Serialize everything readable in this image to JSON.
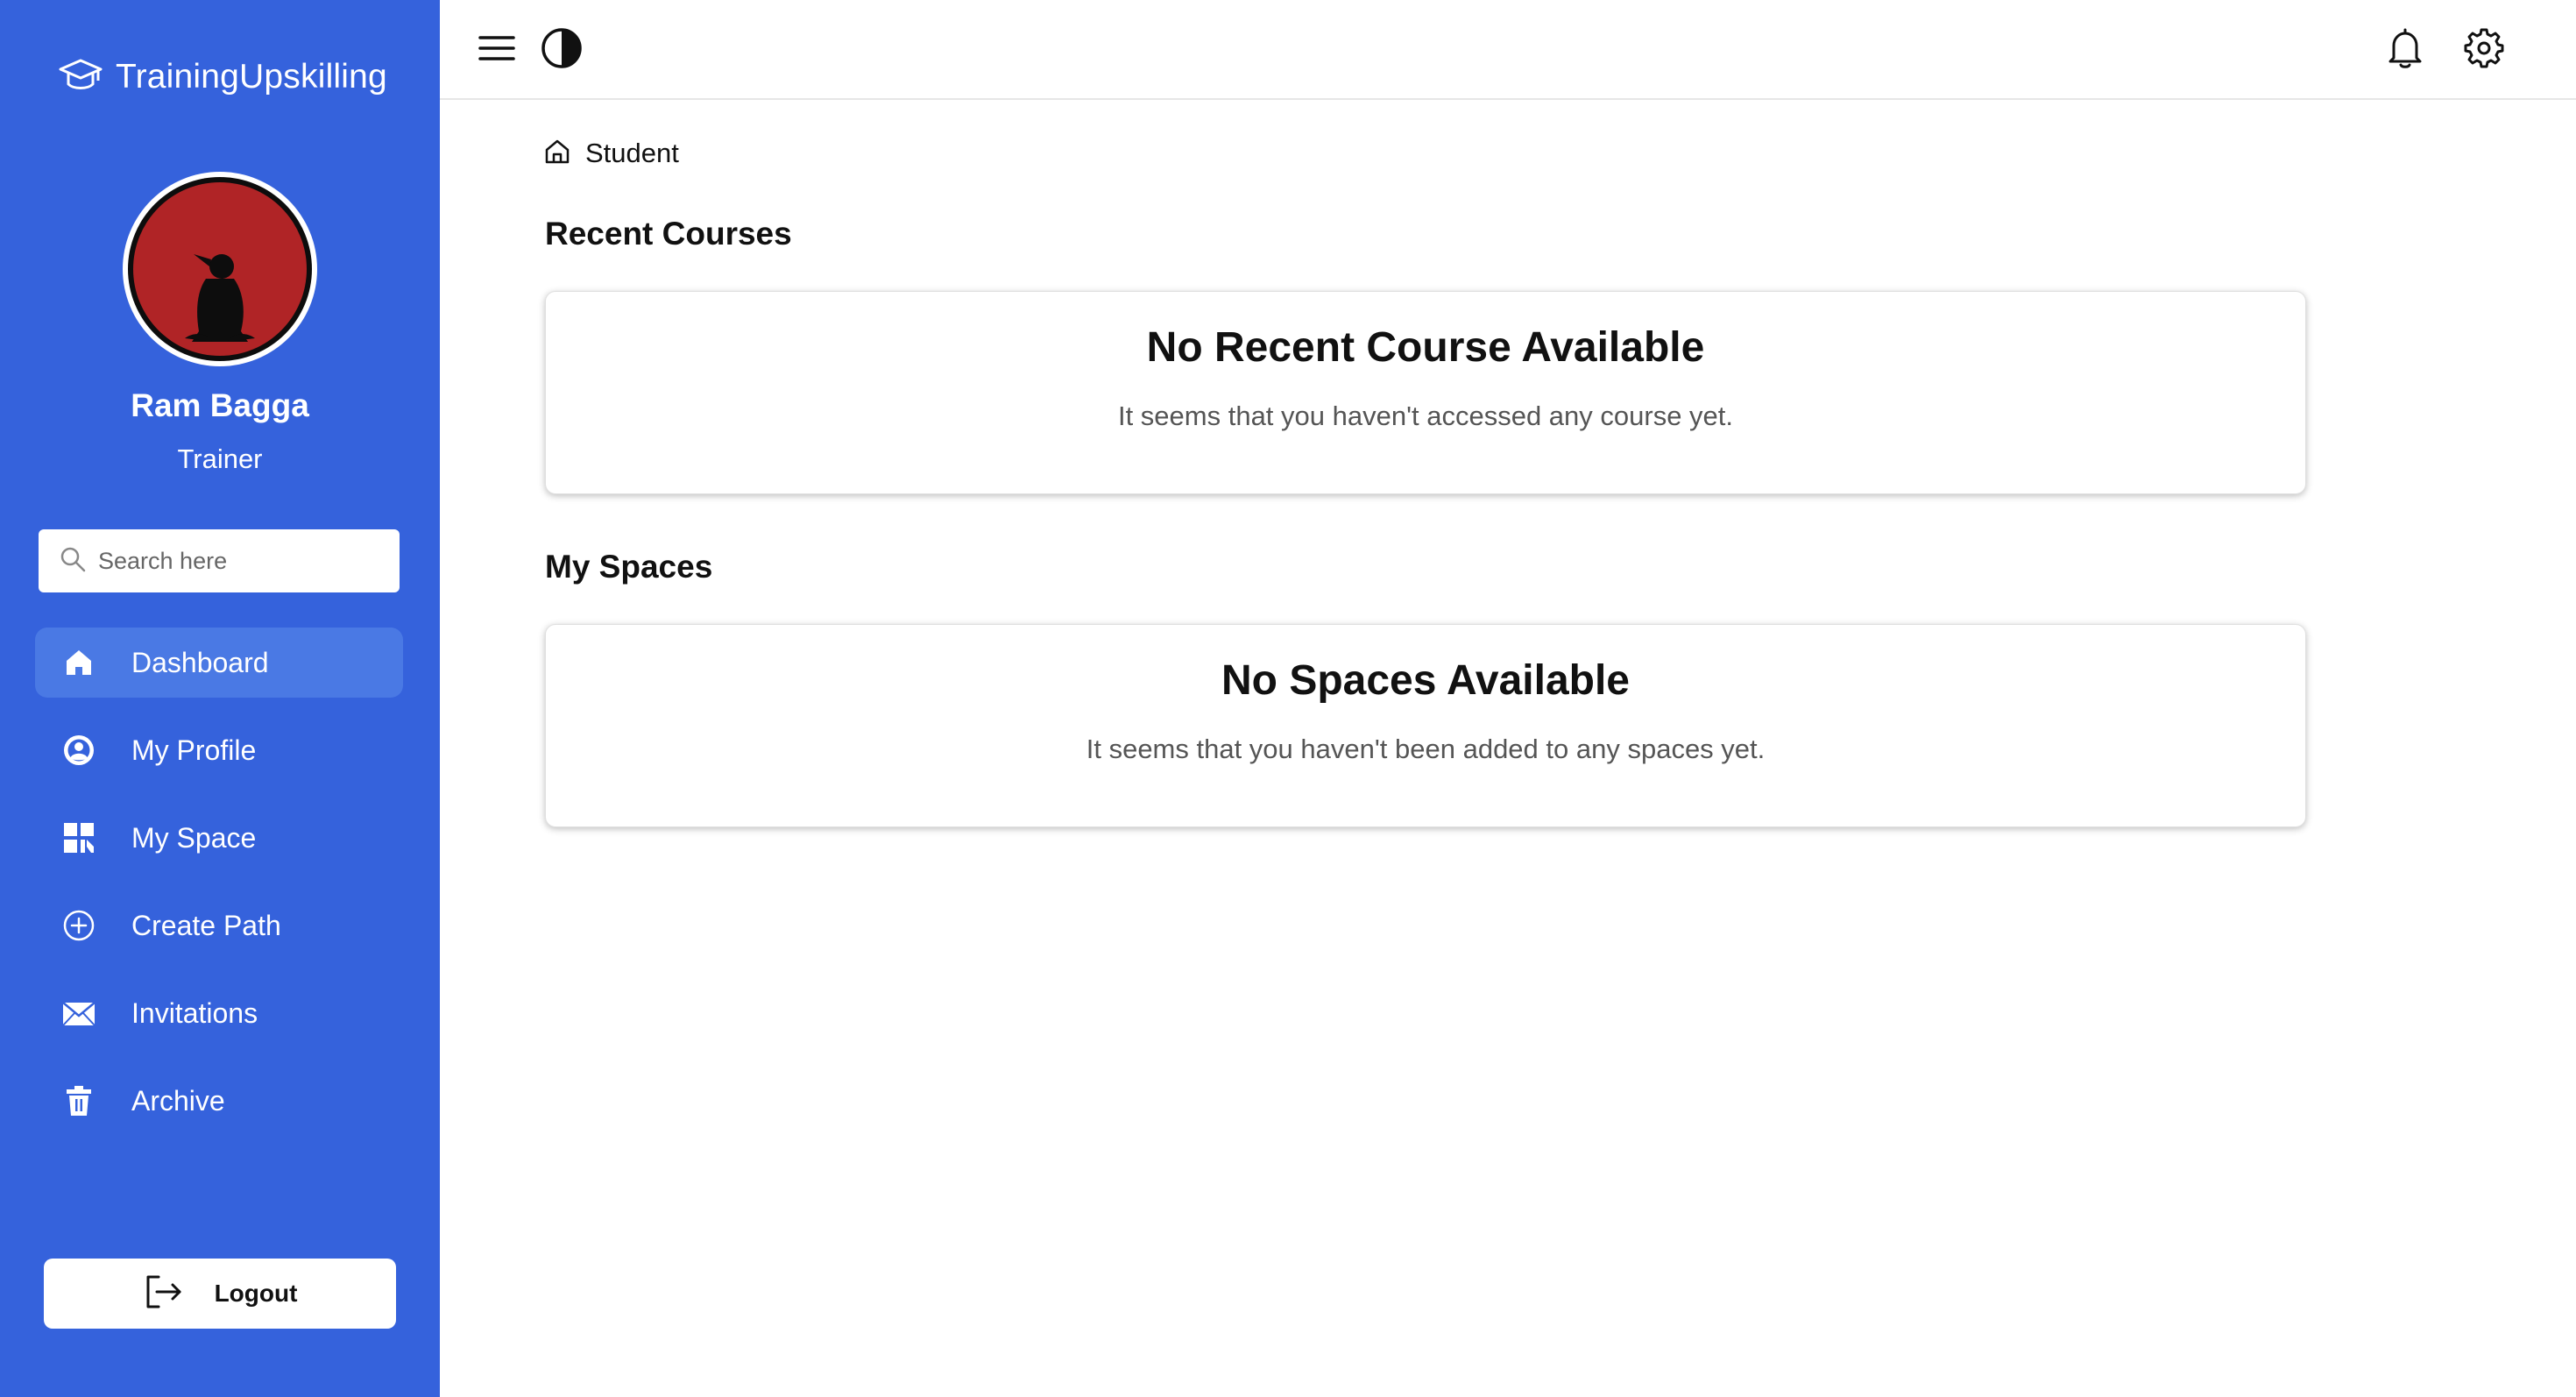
{
  "brand": {
    "name": "TrainingUpskilling"
  },
  "user": {
    "name": "Ram Bagga",
    "role": "Trainer"
  },
  "search": {
    "placeholder": "Search here"
  },
  "nav": {
    "items": [
      {
        "label": "Dashboard",
        "icon": "home-icon",
        "active": true
      },
      {
        "label": "My Profile",
        "icon": "user-circle-icon"
      },
      {
        "label": "My Space",
        "icon": "grid-icon"
      },
      {
        "label": "Create Path",
        "icon": "plus-circle-icon"
      },
      {
        "label": "Invitations",
        "icon": "mail-icon"
      },
      {
        "label": "Archive",
        "icon": "trash-icon"
      }
    ]
  },
  "logout": {
    "label": "Logout"
  },
  "breadcrumb": {
    "current": "Student"
  },
  "recent_courses": {
    "title": "Recent Courses",
    "empty_title": "No Recent Course Available",
    "empty_text": "It seems that you haven't accessed any course yet."
  },
  "my_spaces": {
    "title": "My Spaces",
    "empty_title": "No Spaces Available",
    "empty_text": "It seems that you haven't been added to any spaces yet."
  },
  "colors": {
    "sidebar": "#3562dc",
    "nav_active": "#4a79e4",
    "avatar_bg": "#b02426"
  }
}
